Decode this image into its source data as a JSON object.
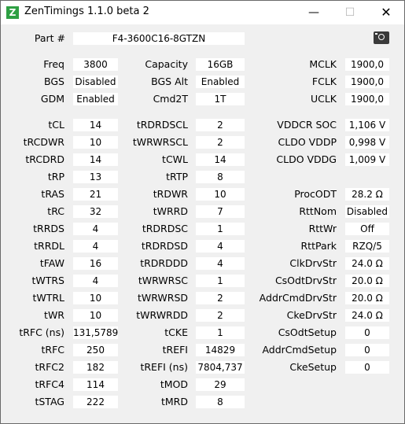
{
  "window": {
    "title": "ZenTimings 1.1.0 beta 2",
    "icon_letter": "Z",
    "minimize": "—",
    "maximize": "☐",
    "close": "✕"
  },
  "part": {
    "label": "Part #",
    "value": "F4-3600C16-8GTZN"
  },
  "top": {
    "col1": [
      {
        "label": "Freq",
        "value": "3800"
      },
      {
        "label": "BGS",
        "value": "Disabled"
      },
      {
        "label": "GDM",
        "value": "Enabled"
      }
    ],
    "col2": [
      {
        "label": "Capacity",
        "value": "16GB"
      },
      {
        "label": "BGS Alt",
        "value": "Enabled"
      },
      {
        "label": "Cmd2T",
        "value": "1T"
      }
    ],
    "col3": [
      {
        "label": "MCLK",
        "value": "1900,0"
      },
      {
        "label": "FCLK",
        "value": "1900,0"
      },
      {
        "label": "UCLK",
        "value": "1900,0"
      }
    ]
  },
  "timings": {
    "col1": [
      {
        "label": "tCL",
        "value": "14"
      },
      {
        "label": "tRCDWR",
        "value": "10"
      },
      {
        "label": "tRCDRD",
        "value": "14"
      },
      {
        "label": "tRP",
        "value": "13"
      },
      {
        "label": "tRAS",
        "value": "21"
      },
      {
        "label": "tRC",
        "value": "32"
      },
      {
        "label": "tRRDS",
        "value": "4"
      },
      {
        "label": "tRRDL",
        "value": "4"
      },
      {
        "label": "tFAW",
        "value": "16"
      },
      {
        "label": "tWTRS",
        "value": "4"
      },
      {
        "label": "tWTRL",
        "value": "10"
      },
      {
        "label": "tWR",
        "value": "10"
      },
      {
        "label": "tRFC (ns)",
        "value": "131,5789"
      },
      {
        "label": "tRFC",
        "value": "250"
      },
      {
        "label": "tRFC2",
        "value": "182"
      },
      {
        "label": "tRFC4",
        "value": "114"
      },
      {
        "label": "tSTAG",
        "value": "222"
      }
    ],
    "col2": [
      {
        "label": "tRDRDSCL",
        "value": "2"
      },
      {
        "label": "tWRWRSCL",
        "value": "2"
      },
      {
        "label": "tCWL",
        "value": "14"
      },
      {
        "label": "tRTP",
        "value": "8"
      },
      {
        "label": "tRDWR",
        "value": "10"
      },
      {
        "label": "tWRRD",
        "value": "7"
      },
      {
        "label": "tRDRDSC",
        "value": "1"
      },
      {
        "label": "tRDRDSD",
        "value": "4"
      },
      {
        "label": "tRDRDDD",
        "value": "4"
      },
      {
        "label": "tWRWRSC",
        "value": "1"
      },
      {
        "label": "tWRWRSD",
        "value": "2"
      },
      {
        "label": "tWRWRDD",
        "value": "2"
      },
      {
        "label": "tCKE",
        "value": "1"
      },
      {
        "label": "tREFI",
        "value": "14829"
      },
      {
        "label": "tREFI (ns)",
        "value": "7804,737"
      },
      {
        "label": "tMOD",
        "value": "29"
      },
      {
        "label": "tMRD",
        "value": "8"
      }
    ],
    "col3": [
      {
        "label": "VDDCR SOC",
        "value": "1,106 V"
      },
      {
        "label": "CLDO VDDP",
        "value": "0,998 V"
      },
      {
        "label": "CLDO VDDG",
        "value": "1,009 V"
      },
      {
        "label": "",
        "value": ""
      },
      {
        "label": "ProcODT",
        "value": "28.2 Ω"
      },
      {
        "label": "RttNom",
        "value": "Disabled"
      },
      {
        "label": "RttWr",
        "value": "Off"
      },
      {
        "label": "RttPark",
        "value": "RZQ/5"
      },
      {
        "label": "ClkDrvStr",
        "value": "24.0 Ω"
      },
      {
        "label": "CsOdtDrvStr",
        "value": "20.0 Ω"
      },
      {
        "label": "AddrCmdDrvStr",
        "value": "20.0 Ω"
      },
      {
        "label": "CkeDrvStr",
        "value": "24.0 Ω"
      },
      {
        "label": "CsOdtSetup",
        "value": "0"
      },
      {
        "label": "AddrCmdSetup",
        "value": "0"
      },
      {
        "label": "CkeSetup",
        "value": "0"
      }
    ]
  },
  "icons": {
    "screenshot_button": "camera-icon"
  }
}
